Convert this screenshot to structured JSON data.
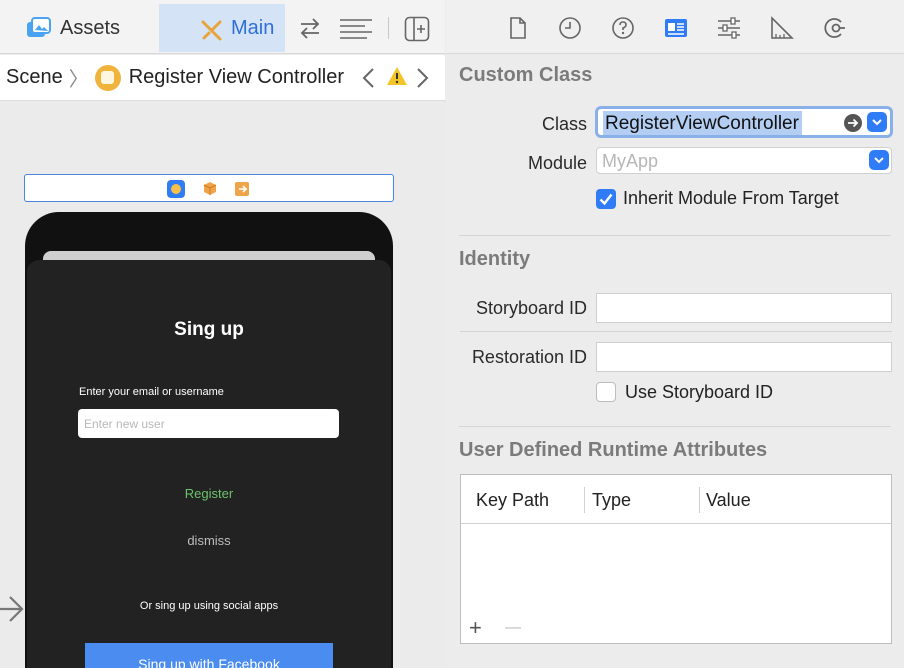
{
  "toolbar": {
    "assets_tab": "Assets",
    "main_tab": "Main",
    "assets_icon": "photo-stack-icon",
    "main_icon": "storyboard-icon",
    "swap_icon": "swap-arrows-icon",
    "lines_icon": "lines-icon",
    "add_editor_icon": "add-editor-icon"
  },
  "breadcrumb": {
    "scene": "Scene",
    "controller": "Register View Controller",
    "warning_icon": "warning-icon"
  },
  "scene_bar": {
    "icons": [
      "view-controller-icon",
      "first-responder-icon",
      "exit-icon"
    ]
  },
  "app_screen": {
    "title": "Sing up",
    "email_label": "Enter your email or username",
    "email_placeholder": "Enter new user",
    "register": "Register",
    "dismiss": "dismiss",
    "social_text": "Or sing up using social apps",
    "facebook_button": "Sing up with Facebook"
  },
  "inspector": {
    "tabs": [
      "file-icon",
      "history-icon",
      "help-icon",
      "identity-icon",
      "attributes-icon",
      "size-icon",
      "connections-icon"
    ],
    "active_tab": "identity-icon",
    "custom_class": {
      "title": "Custom Class",
      "class_label": "Class",
      "class_value": "RegisterViewController",
      "module_label": "Module",
      "module_placeholder": "MyApp",
      "inherit_label": "Inherit Module From Target",
      "inherit_checked": true
    },
    "identity": {
      "title": "Identity",
      "storyboard_id_label": "Storyboard ID",
      "storyboard_id_value": "",
      "restoration_id_label": "Restoration ID",
      "restoration_id_value": "",
      "use_storyboard_id_label": "Use Storyboard ID",
      "use_storyboard_id_checked": false
    },
    "runtime_attributes": {
      "title": "User Defined Runtime Attributes",
      "columns": [
        "Key Path",
        "Type",
        "Value"
      ],
      "add": "+",
      "remove": "—"
    }
  },
  "colors": {
    "accent": "#2f7cf6",
    "selection": "#b3cdf3",
    "register_green": "#6dc36d",
    "facebook_blue": "#4b8cf0",
    "dark_bg": "#222222"
  }
}
